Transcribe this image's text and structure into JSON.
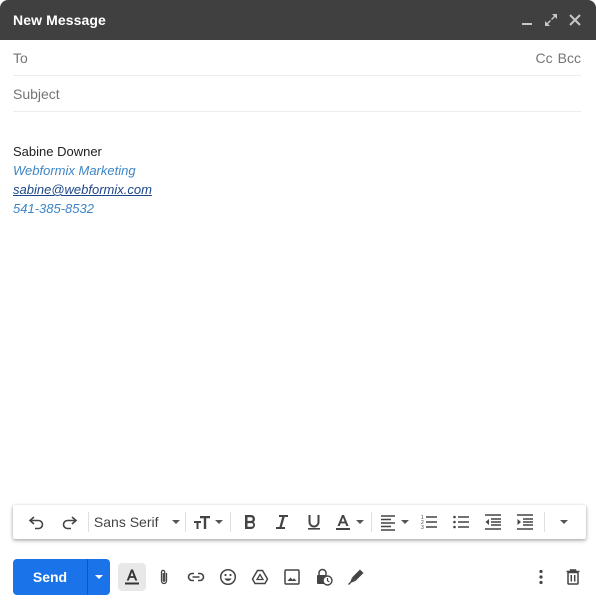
{
  "window": {
    "title": "New Message",
    "controls": [
      {
        "name": "minimize-icon",
        "label": "Minimize"
      },
      {
        "name": "fullscreen-icon",
        "label": "Full screen"
      },
      {
        "name": "close-icon",
        "label": "Save & close"
      }
    ]
  },
  "fields": {
    "to_label": "To",
    "to_value": "",
    "cc_label": "Cc",
    "bcc_label": "Bcc",
    "subject_placeholder": "Subject",
    "subject_value": ""
  },
  "signature": {
    "name": "Sabine Downer",
    "company": "Webformix Marketing",
    "email": "sabine@webformix.com",
    "phone": "541-385-8532"
  },
  "formatting": {
    "font": "Sans Serif",
    "buttons": [
      "undo-icon",
      "redo-icon",
      "font-select",
      "text-size-icon",
      "bold-icon",
      "italic-icon",
      "underline-icon",
      "text-color-icon",
      "align-icon",
      "numbered-list-icon",
      "bulleted-list-icon",
      "indent-less-icon",
      "indent-more-icon",
      "more-formatting-icon"
    ]
  },
  "bottom": {
    "send_label": "Send",
    "icons": [
      "formatting-options-icon",
      "attach-file-icon",
      "insert-link-icon",
      "emoji-icon",
      "drive-icon",
      "insert-photo-icon",
      "confidential-mode-icon",
      "signature-icon",
      "more-options-icon",
      "discard-icon"
    ]
  },
  "colors": {
    "titlebar": "#404040",
    "send_button": "#1a73e8",
    "signature_blue": "#3d85c6",
    "link_blue": "#1c4587"
  }
}
